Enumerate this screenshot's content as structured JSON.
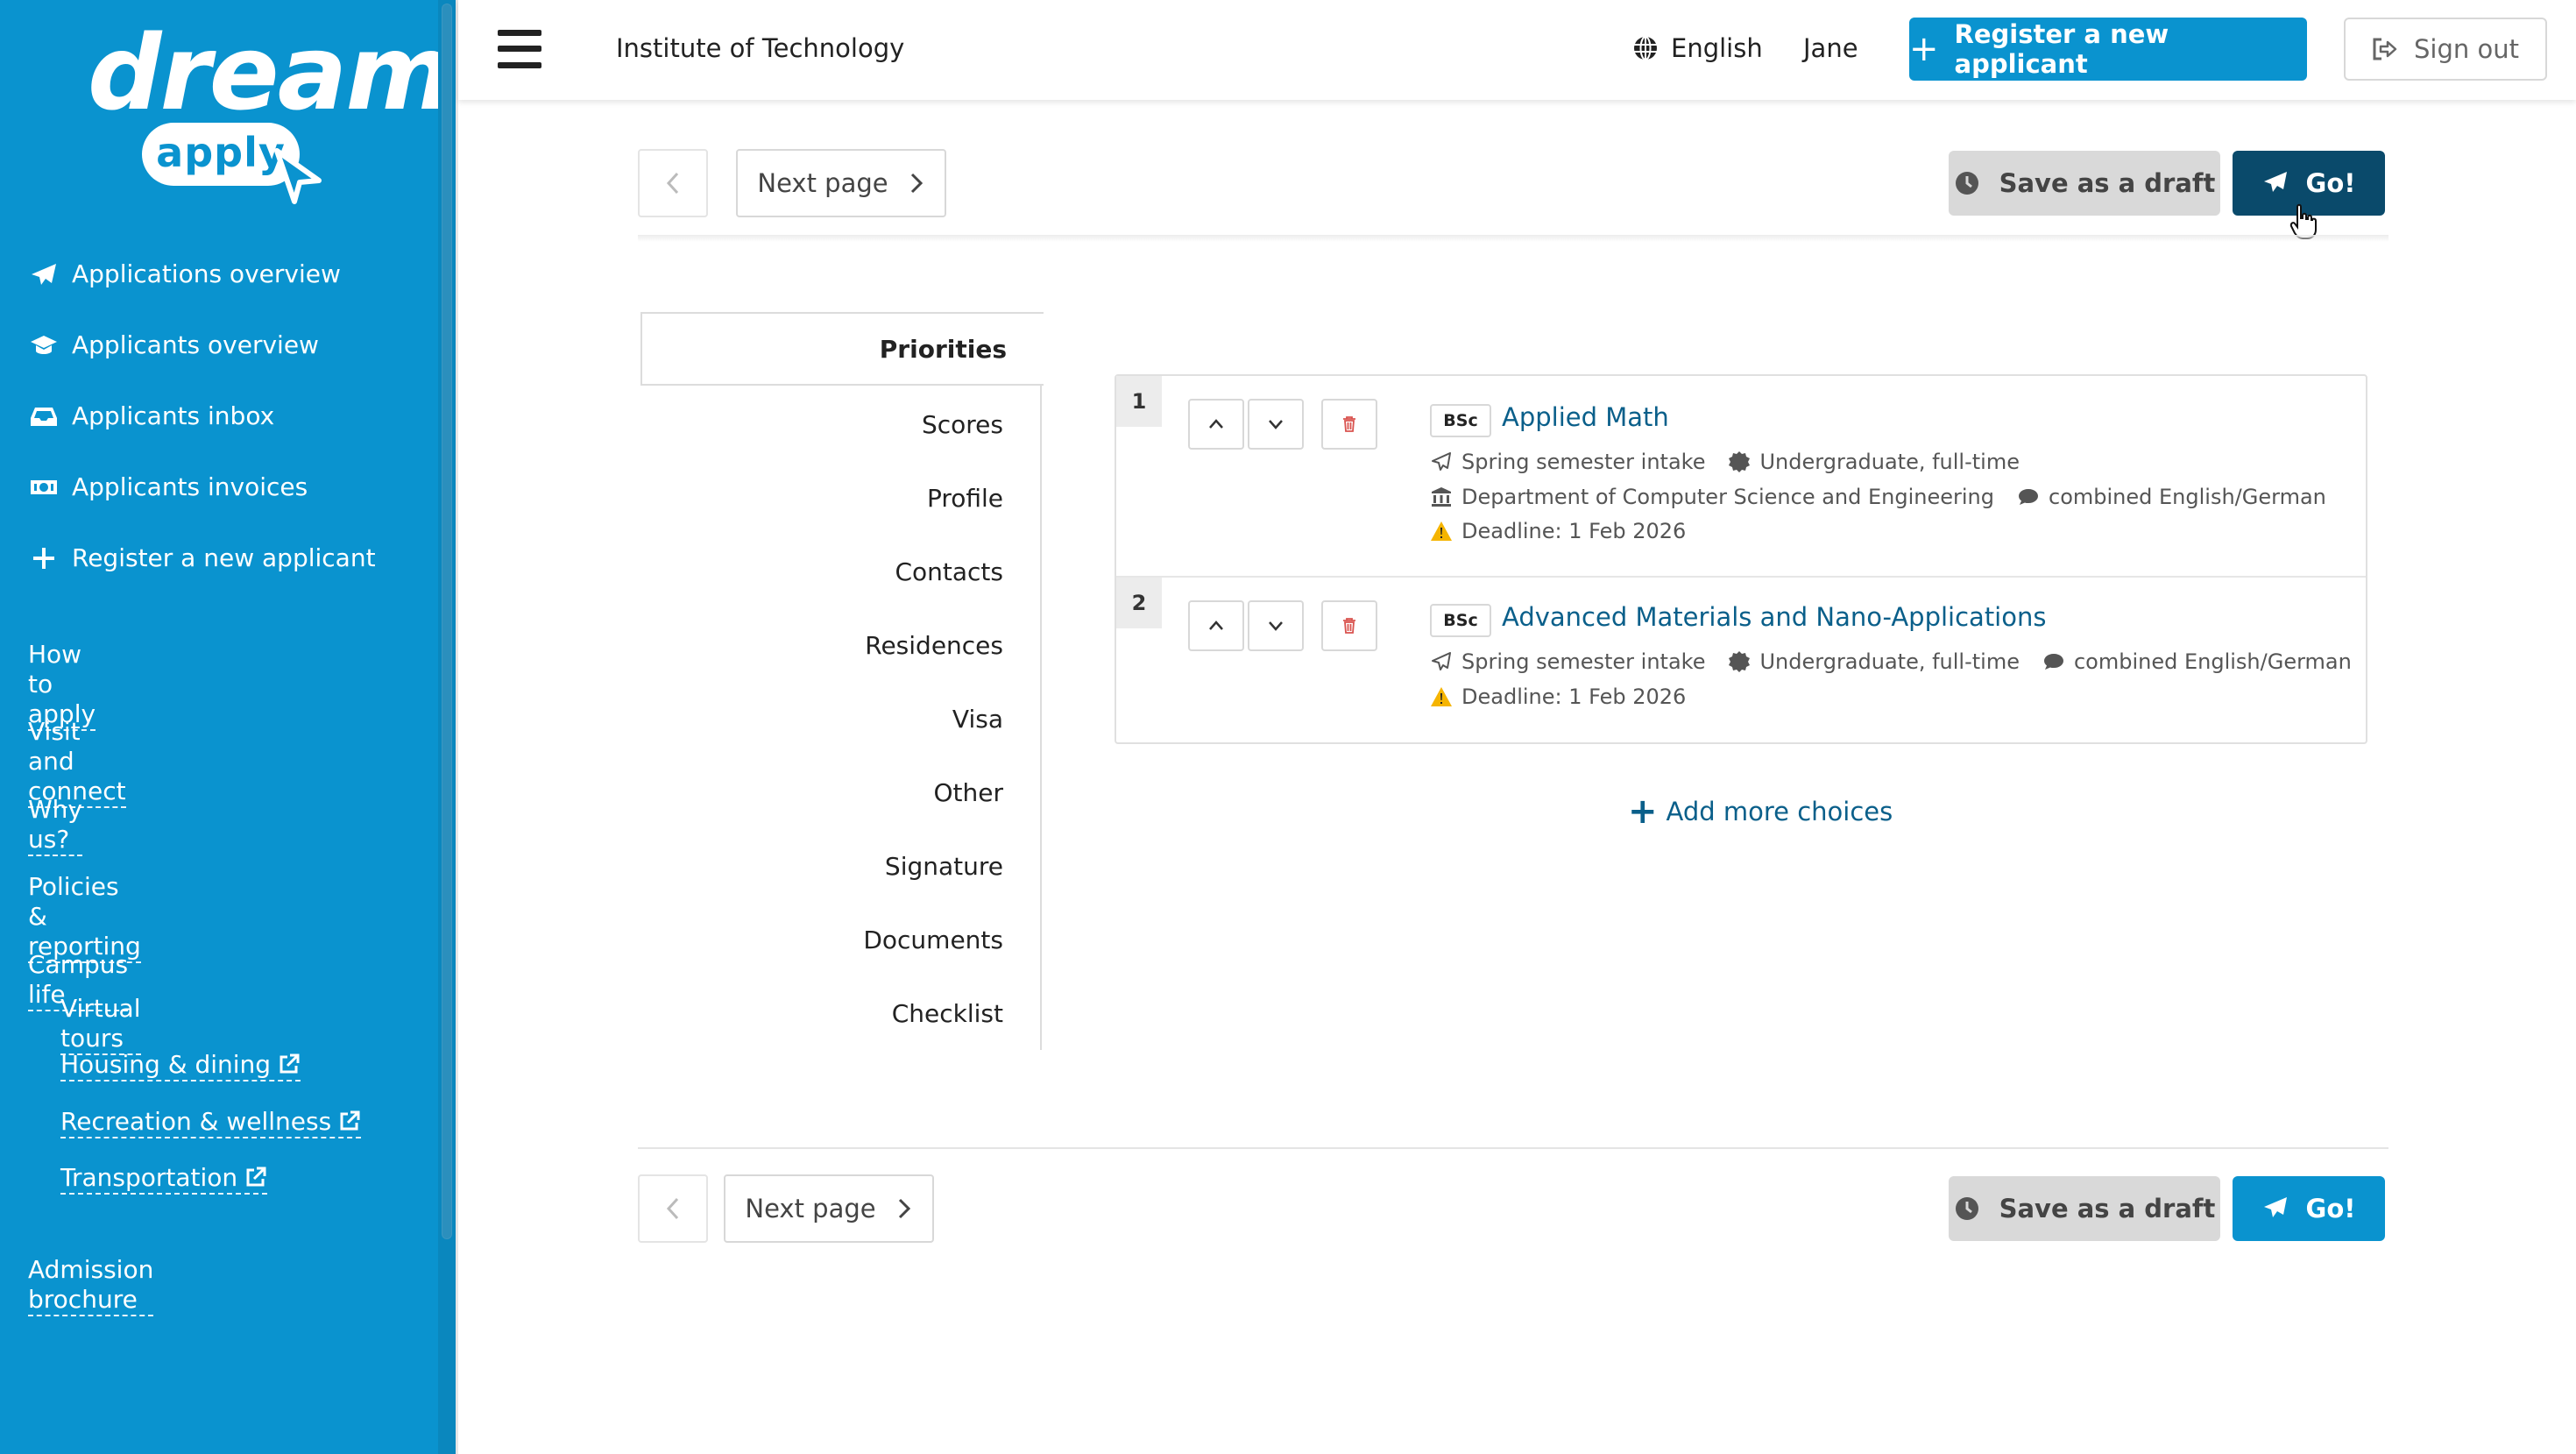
{
  "brand": {
    "logo_word": "dream",
    "logo_badge": "apply"
  },
  "sidebar": {
    "nav": [
      {
        "label": "Applications overview",
        "icon": "paper-plane-icon"
      },
      {
        "label": "Applicants overview",
        "icon": "graduation-cap-icon"
      },
      {
        "label": "Applicants inbox",
        "icon": "inbox-icon"
      },
      {
        "label": "Applicants invoices",
        "icon": "money-icon"
      },
      {
        "label": "Register a new applicant",
        "icon": "plus-icon"
      }
    ],
    "links": {
      "how_to_apply": "How to apply",
      "visit_and_connect": "Visit and connect",
      "why_us": "Why us?",
      "policies": "Policies & reporting",
      "campus_life": "Campus life",
      "virtual_tours": "Virtual tours",
      "housing": "Housing & dining",
      "recreation": "Recreation & wellness",
      "transportation": "Transportation",
      "brochure": "Admission brochure"
    }
  },
  "header": {
    "org": "Institute of Technology",
    "language": "English",
    "user": "Jane",
    "register_label": "Register a new applicant",
    "signout_label": "Sign out"
  },
  "toolbar": {
    "next_label": "Next page",
    "draft_label": "Save as a draft",
    "go_label": "Go!"
  },
  "tabs": [
    "Priorities",
    "Scores",
    "Profile",
    "Contacts",
    "Residences",
    "Visa",
    "Other",
    "Signature",
    "Documents",
    "Checklist"
  ],
  "choices": [
    {
      "num": "1",
      "degree": "BSc",
      "title": "Applied Math",
      "intake": "Spring semester intake",
      "level": "Undergraduate, full-time",
      "department": "Department of Computer Science and Engineering",
      "language": "combined English/German",
      "deadline": "Deadline: 1 Feb 2026"
    },
    {
      "num": "2",
      "degree": "BSc",
      "title": "Advanced Materials and Nano-Applications",
      "intake": "Spring semester intake",
      "level": "Undergraduate, full-time",
      "language": "combined English/German",
      "deadline": "Deadline: 1 Feb 2026"
    }
  ],
  "add_more_label": "Add more choices",
  "colors": {
    "brand": "#0a93cf",
    "go_active": "#0a4a6b",
    "link": "#0a5f8a",
    "warning": "#f5b400",
    "delete": "#d9534f"
  }
}
